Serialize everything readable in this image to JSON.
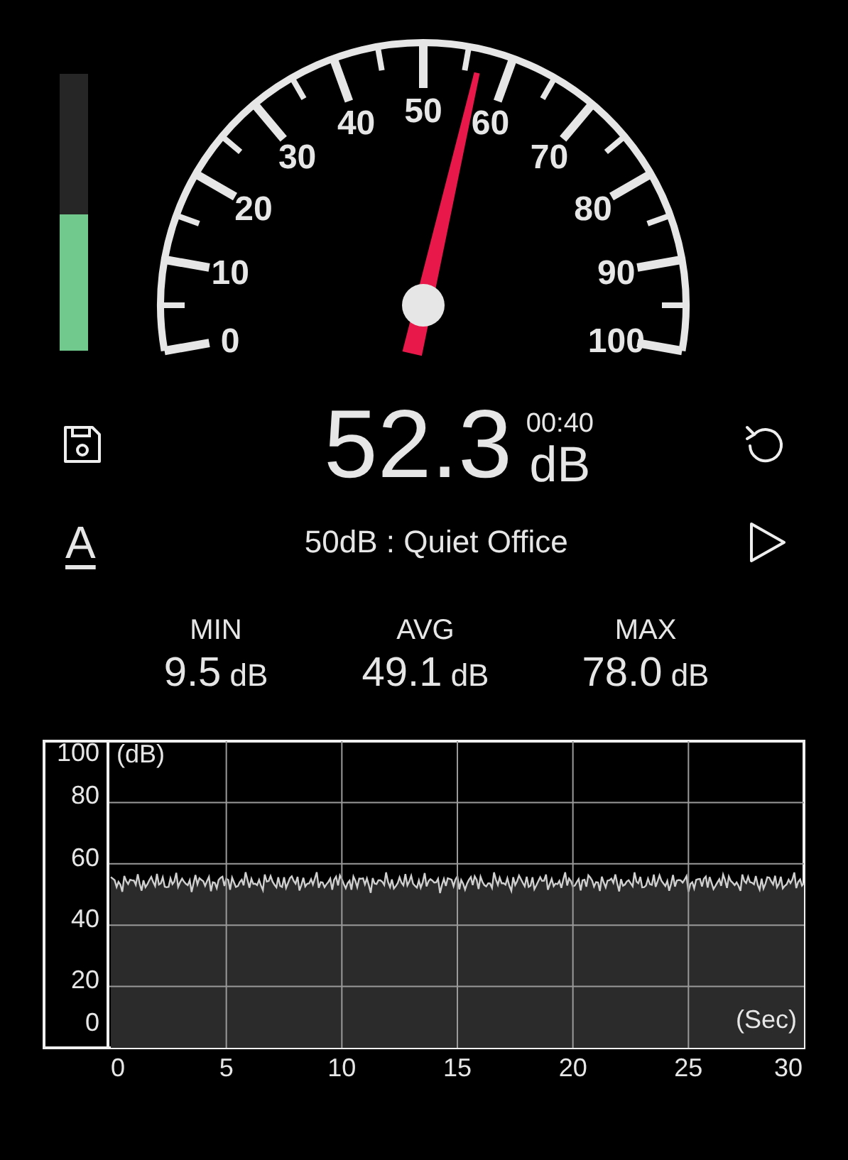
{
  "level_meter": {
    "level": 0.49
  },
  "gauge": {
    "scale_labels": [
      "50",
      "40",
      "60",
      "30",
      "70",
      "20",
      "80",
      "10",
      "90",
      "0",
      "100"
    ]
  },
  "reading": {
    "value": "52.3",
    "unit": "dB",
    "elapsed": "00:40"
  },
  "font_button": "A",
  "noise_class": "50dB : Quiet Office",
  "stats": [
    {
      "label": "MIN",
      "value": "9.5",
      "unit": "dB"
    },
    {
      "label": "AVG",
      "value": "49.1",
      "unit": "dB"
    },
    {
      "label": "MAX",
      "value": "78.0",
      "unit": "dB"
    }
  ],
  "chart": {
    "y_unit": "(dB)",
    "x_unit": "(Sec)",
    "yticks": [
      "100",
      "80",
      "60",
      "40",
      "20",
      "0"
    ],
    "xticks": [
      "0",
      "5",
      "10",
      "15",
      "20",
      "25",
      "30"
    ]
  }
}
